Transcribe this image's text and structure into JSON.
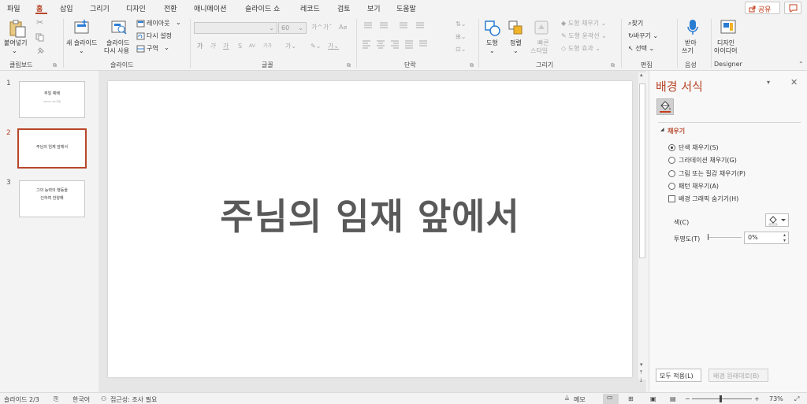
{
  "menu": {
    "tabs": [
      "파일",
      "홈",
      "삽입",
      "그리기",
      "디자인",
      "전환",
      "애니메이션",
      "슬라이드 쇼",
      "레코드",
      "검토",
      "보기",
      "도움말"
    ],
    "share_label": "공유"
  },
  "ribbon": {
    "clipboard": {
      "paste_label": "붙여넣기",
      "group_label": "클립보드"
    },
    "slides": {
      "new_slide_label": "새 슬라이드",
      "reuse_label_1": "슬라이드",
      "reuse_label_2": "다시 사용",
      "layout_label": "레이아웃",
      "reset_label": "다시 설정",
      "section_label": "구역",
      "group_label": "슬라이드"
    },
    "font": {
      "font_size": "60",
      "bold": "가",
      "italic": "가",
      "underline": "가",
      "strike": "S",
      "spacing": "AV",
      "case": "가가",
      "group_label": "글꼴"
    },
    "paragraph": {
      "group_label": "단락"
    },
    "drawing": {
      "shapes_label": "도형",
      "arrange_label": "정렬",
      "quick_styles_1": "빠른",
      "quick_styles_2": "스타일",
      "shape_fill": "도형 채우기",
      "shape_outline": "도형 윤곽선",
      "shape_effects": "도형 효과",
      "group_label": "그리기"
    },
    "editing": {
      "find": "찾기",
      "replace": "바꾸기",
      "select": "선택",
      "group_label": "편집"
    },
    "voice": {
      "dictate_1": "받아",
      "dictate_2": "쓰기",
      "group_label": "음성"
    },
    "designer": {
      "ideas_1": "디자인",
      "ideas_2": "아이디어",
      "group_label": "Designer"
    }
  },
  "thumbnails": [
    {
      "num": "1",
      "lines": [
        "주일 예배",
        "",
        "2023.1.00.주일"
      ]
    },
    {
      "num": "2",
      "lines": [
        "주님의 임재 앞에서"
      ]
    },
    {
      "num": "3",
      "lines": [
        "그의 능력의 행동을",
        "",
        "인하여 찬양해"
      ]
    }
  ],
  "slide": {
    "title": "주님의 임재 앞에서"
  },
  "format_pane": {
    "title": "배경 서식",
    "section": "채우기",
    "options": [
      {
        "label": "단색 채우기(S)",
        "selected": true
      },
      {
        "label": "그라데이션 채우기(G)",
        "selected": false
      },
      {
        "label": "그림 또는 질감 채우기(P)",
        "selected": false
      },
      {
        "label": "패턴 채우기(A)",
        "selected": false
      }
    ],
    "hide_graphics": "배경 그래픽 숨기기(H)",
    "color_label": "색(C)",
    "transparency_label": "투명도(T)",
    "transparency_value": "0%",
    "apply_all": "모두 적용(L)",
    "reset_bg": "배경 원래대로(B)"
  },
  "status": {
    "slide_counter": "슬라이드 2/3",
    "language": "한국어",
    "accessibility": "접근성: 조사 필요",
    "notes": "메모",
    "zoom": "73%"
  },
  "colors": {
    "accent": "#b7472a",
    "ribbon_bg": "#f3f3f3",
    "icon_blue": "#2b7cd3"
  }
}
